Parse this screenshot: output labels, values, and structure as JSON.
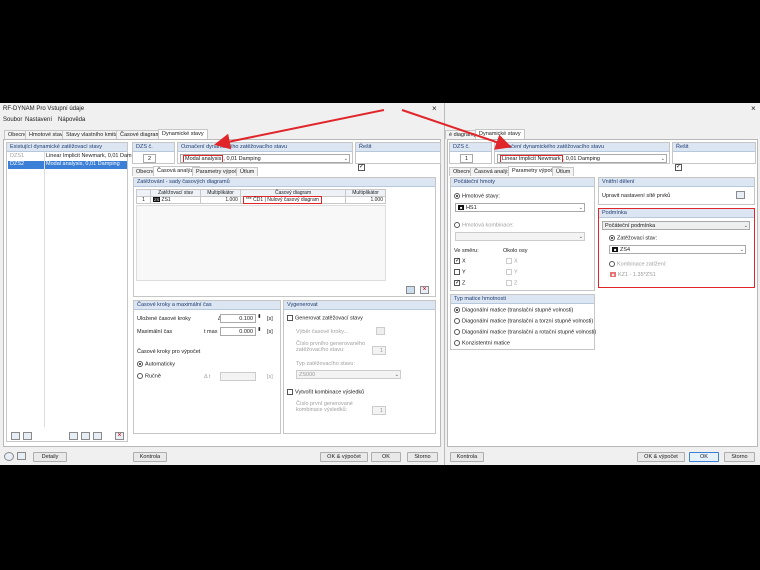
{
  "left": {
    "title": "RF-DYNAM Pro Vstupní údaje",
    "menu": [
      "Soubor",
      "Nastavení",
      "Nápověda"
    ],
    "tabs": [
      "Obecné",
      "Hmotové stavy",
      "Stavy vlastního kmitání",
      "Časové diagramy",
      "Dynamické stavy"
    ],
    "list_header": "Existující dynamické zatěžovací stavy",
    "list_items": [
      {
        "id": "DZS1",
        "desc": "Linear Implicit Newmark, 0,01 Dam"
      },
      {
        "id": "DZS2",
        "desc": "Modal analysis, 0,01 Damping"
      }
    ],
    "dzs_label": "DZS č.",
    "dzs_value": "2",
    "name_label": "Označení dynamického zatěžovacího stavu",
    "name_highlight": "Modal analysis",
    "name_rest": ", 0,01 Damping",
    "resit_label": "Řešit",
    "sub_tabs": [
      "Obecné",
      "Časová analýza",
      "Parametry výpočtu",
      "Útlum"
    ],
    "diag_header": "Zatěžování - sady časových diagramů",
    "table_headers": [
      "",
      "Zatěžovací stav",
      "Multiplikátor",
      "Časový diagram",
      "Multiplikátor"
    ],
    "table_row": {
      "no": "1",
      "ls_badge": "ZS",
      "ls": "ZS1",
      "mult1": "1.000",
      "diag": "*** ČD1 | Nulový časový diagram",
      "mult2": "1.000"
    },
    "time_header": "Časové kroky a maximální čas",
    "step_label": "Uložené časové kroky",
    "step_sym": "Δ t",
    "step_value": "0.100",
    "step_unit": "[s]",
    "max_label": "Maximální čas",
    "max_sym": "t max",
    "max_value": "0.000",
    "max_unit": "[s]",
    "calc_label": "Časové kroky pro výpočet",
    "auto_label": "Automaticky",
    "manual_label": "Ručně",
    "manual_sym": "Δ t",
    "manual_unit": "[s]",
    "gen_header": "Vygenerovat",
    "gen_check": "Generovat zatěžovací stavy",
    "gen_l1": "Výběr časové kroky...",
    "gen_l2": "Číslo prvního generovaného zatěžovacího stavu:",
    "gen_v2": "1",
    "gen_l3": "Typ zatěžovacího stavu:",
    "gen_v3": "ZS000",
    "gen_check2": "Vytvořit kombinace výsledků",
    "gen_l4": "Číslo první generované kombinace výsledků:",
    "gen_v4": "1",
    "btn_details": "Detaily",
    "btn_control": "Kontrola",
    "btn_okcalc": "OK & výpočet",
    "btn_ok": "OK",
    "btn_cancel": "Storno"
  },
  "right": {
    "tabs": [
      "é diagramy",
      "Dynamické stavy"
    ],
    "dzs_label": "DZS č.",
    "dzs_value": "1",
    "name_label": "Označení dynamického zatěžovacího stavu",
    "name_highlight": "Linear Implicit Newmark",
    "name_rest": ", 0,01 Damping",
    "resit_label": "Řešit",
    "sub_tabs": [
      "Obecné",
      "Časová analýza",
      "Parametry výpočtu",
      "Útlum"
    ],
    "init_header": "Počáteční hmoty",
    "ready_label": "Hmotové stavy:",
    "ready_value": "HS1",
    "mass_combo_label": "Hmotová kombinace:",
    "dir_label": "Ve směru:",
    "axis_label": "Okolo osy",
    "dirs": [
      "X",
      "Y",
      "Z"
    ],
    "matrix_header": "Typ matice hmotnosti",
    "matrix_opts": [
      "Diagonální matice (translační stupně volnosti)",
      "Diagonální matice (translační a torzní stupně volnosti)",
      "Diagonální matice (translační a rotační stupně volnosti)",
      "Konzistentní matice"
    ],
    "inner_header": "Vnitřní dělení",
    "inner_label": "Upravit nastavení sítě prvků",
    "cond_header": "Podmínka",
    "cond_select": "Počáteční podmínka",
    "cond_radio": "Zatěžovací stav:",
    "cond_ls": "ZS4",
    "cond_combo": "Kombinace zatížení:",
    "cond_combo_val": "KZ1 - 1.35*ZS1",
    "btn_control": "Kontrola",
    "btn_okcalc": "OK & výpočet",
    "btn_ok": "OK",
    "btn_cancel": "Storno"
  },
  "colors": {
    "highlight": "#e0262b",
    "header_bg": "#dce6f2",
    "select_bg": "#3b7fd6"
  }
}
